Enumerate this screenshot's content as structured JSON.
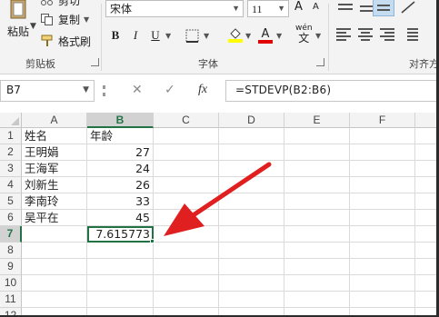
{
  "ribbon": {
    "clipboard": {
      "cut_label": "剪切",
      "copy_label": "复制",
      "format_painter_label": "格式刷",
      "paste_label": "粘贴",
      "group_label": "剪贴板"
    },
    "font": {
      "font_name": "宋体",
      "font_size": "11",
      "bold": "B",
      "italic": "I",
      "underline": "U",
      "font_color_glyph": "A",
      "phonetic_top": "wén",
      "phonetic_bottom": "文",
      "group_label": "字体",
      "grow_glyph": "A",
      "shrink_glyph": "A"
    },
    "alignment": {
      "group_label": "对齐方"
    },
    "colors": {
      "accent": "#217346",
      "fill_color": "#ffff00",
      "font_color": "#e00000"
    }
  },
  "formula_bar": {
    "name_box": "B7",
    "cancel_glyph": "✕",
    "enter_glyph": "✓",
    "fx": "fx",
    "formula": "=STDEVP(B2:B6)"
  },
  "sheet": {
    "columns": [
      "A",
      "B",
      "C",
      "D",
      "E",
      "F"
    ],
    "rows": [
      "1",
      "2",
      "3",
      "4",
      "5",
      "6",
      "7",
      "8",
      "9",
      "10",
      "11",
      "12"
    ],
    "selected_cell": "B7",
    "cells": {
      "A1": "姓名",
      "B1": "年龄",
      "A2": "王明娟",
      "B2": "27",
      "A3": "王海军",
      "B3": "24",
      "A4": "刘新生",
      "B4": "26",
      "A5": "李南玲",
      "B5": "33",
      "A6": "吴平在",
      "B6": "45",
      "B7": "7.615773"
    }
  },
  "annotation": {
    "arrow_color": "#e02020"
  }
}
